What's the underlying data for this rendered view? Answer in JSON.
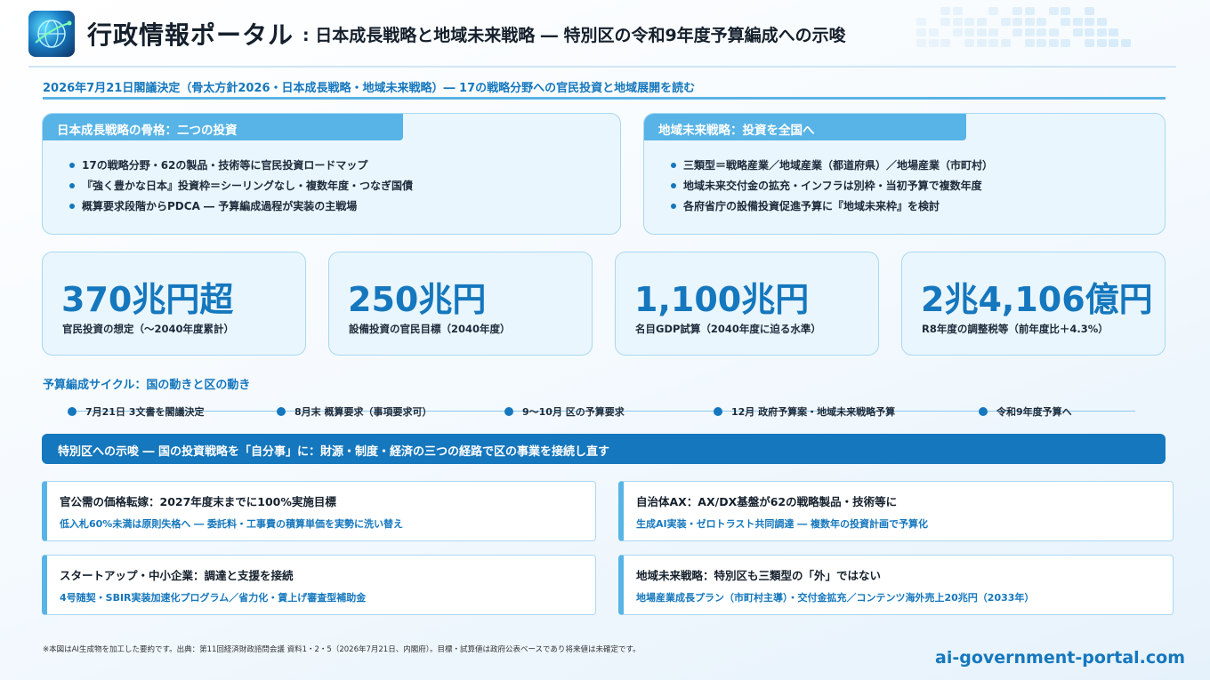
{
  "header": {
    "brand": "行政情報ポータル",
    "title": ": 日本成長戦略と地域未来戦略 ― 特別区の令和9年度予算編成への示唆",
    "logo_icon": "globe-network-icon"
  },
  "subtitle": "2026年7月21日閣議決定（骨太方針2026・日本成長戦略・地域未来戦略）― 17の戦略分野への官民投資と地域展開を読む",
  "growth_panel": {
    "heading": "日本成長戦略の骨格：二つの投資",
    "bullets": [
      "17の戦略分野・62の製品・技術等に官民投資ロードマップ",
      "『強く豊かな日本』投資枠＝シーリングなし・複数年度・つなぎ国債",
      "概算要求段階からPDCA ― 予算編成過程が実装の主戦場"
    ]
  },
  "regional_panel": {
    "heading": "地域未来戦略：投資を全国へ",
    "bullets": [
      "三類型＝戦略産業／地域産業（都道府県）／地場産業（市町村）",
      "地域未来交付金の拡充・インフラは別枠・当初予算で複数年度",
      "各府省庁の設備投資促進予算に『地域未来枠』を検討"
    ]
  },
  "stats": [
    {
      "value": "370兆円超",
      "label": "官民投資の想定（〜2040年度累計）"
    },
    {
      "value": "250兆円",
      "label": "設備投資の官民目標（2040年度）"
    },
    {
      "value": "1,100兆円",
      "label": "名目GDP試算（2040年度に迫る水準）"
    },
    {
      "value": "2兆4,106億円",
      "label": "R8年度の調整税等（前年度比＋4.3%）"
    }
  ],
  "cycle": {
    "title": "予算編成サイクル：国の動きと区の動き",
    "steps": [
      "7月21日 3文書を閣議決定",
      "8月末 概算要求（事項要求可）",
      "9〜10月 区の予算要求",
      "12月 政府予算案・地域未来戦略予算",
      "令和9年度予算へ"
    ]
  },
  "banner": "特別区への示唆 ― 国の投資戦略を「自分事」に：財源・制度・経済の三つの経路で区の事業を接続し直す",
  "cards": [
    {
      "title": "官公需の価格転嫁：2027年度末までに100%実施目標",
      "detail": "低入札60%未満は原則失格へ ― 委託料・工事費の積算単価を実勢に洗い替え"
    },
    {
      "title": "自治体AX：AX/DX基盤が62の戦略製品・技術等に",
      "detail": "生成AI実装・ゼロトラスト共同調達 ― 複数年の投資計画で予算化"
    },
    {
      "title": "スタートアップ・中小企業：調達と支援を接続",
      "detail": "4号随契・SBIR実装加速化プログラム／省力化・賃上げ審査型補助金"
    },
    {
      "title": "地域未来戦略：特別区も三類型の「外」ではない",
      "detail": "地場産業成長プラン（市町村主導）・交付金拡充／コンテンツ海外売上20兆円（2033年）"
    }
  ],
  "footnote": "※本図はAI生成物を加工した要約です。出典：第11回経済財政諮問会議 資料1・2・5（2026年7月21日、内閣府）。目標・試算値は政府公表ベースであり将来値は未確定です。",
  "site_url": "ai-government-portal.com",
  "colors": {
    "accent": "#1577bd",
    "panel_bg": "#eaf6fd",
    "tab": "#58b4e6",
    "border": "#a9d8f2"
  }
}
